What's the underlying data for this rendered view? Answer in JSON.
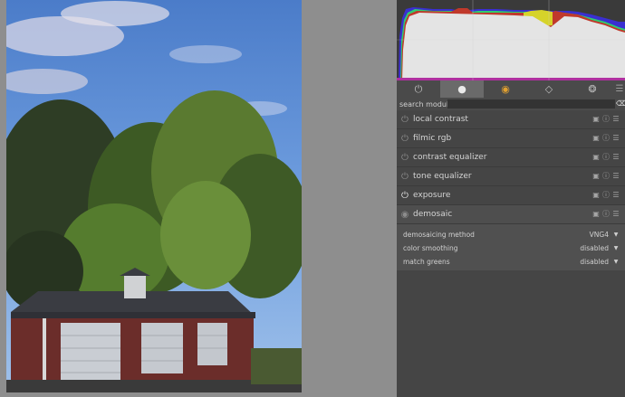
{
  "search": {
    "label": "search module",
    "value": "",
    "clear_icon": "backspace-icon"
  },
  "tabs": [
    {
      "icon": "power-icon",
      "glyph": "⏻",
      "active": false
    },
    {
      "icon": "circle-icon",
      "glyph": "●",
      "active": true
    },
    {
      "icon": "color-wheel-icon",
      "glyph": "◉",
      "active": false
    },
    {
      "icon": "shapes-icon",
      "glyph": "◇",
      "active": false
    },
    {
      "icon": "effects-icon",
      "glyph": "❂",
      "active": false
    }
  ],
  "tab_menu_glyph": "☰",
  "module_icon_glyphs": {
    "presets": "▣",
    "reset": "ⓘ",
    "menu": "☰"
  },
  "modules": [
    {
      "name": "local contrast",
      "power_glyph": "⏻",
      "on": false
    },
    {
      "name": "filmic rgb",
      "power_glyph": "⏻",
      "on": false
    },
    {
      "name": "contrast equalizer",
      "power_glyph": "⏻",
      "on": false
    },
    {
      "name": "tone equalizer",
      "power_glyph": "⏻",
      "on": false
    },
    {
      "name": "exposure",
      "power_glyph": "⏻",
      "on": true
    },
    {
      "name": "demosaic",
      "power_glyph": "◉",
      "on": false,
      "expanded": true
    }
  ],
  "demosaic_params": [
    {
      "label": "demosaicing method",
      "value": "VNG4"
    },
    {
      "label": "color smoothing",
      "value": "disabled"
    },
    {
      "label": "match greens",
      "value": "disabled"
    }
  ],
  "dropdown_glyph": "▼",
  "colors": {
    "hist_red": "#c0392b",
    "hist_green": "#2ecc71",
    "hist_blue": "#3a2fd0",
    "hist_yellow": "#d6d32a"
  }
}
